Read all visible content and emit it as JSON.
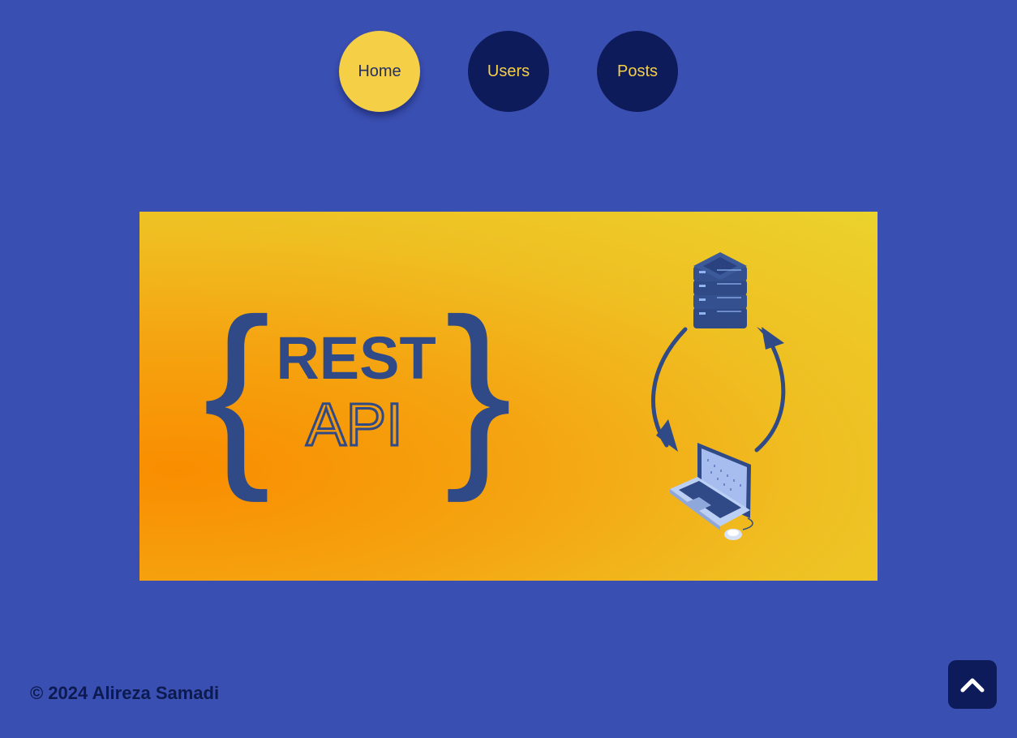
{
  "nav": {
    "items": [
      {
        "label": "Home",
        "active": true
      },
      {
        "label": "Users",
        "active": false
      },
      {
        "label": "Posts",
        "active": false
      }
    ]
  },
  "banner": {
    "title_line1": "REST",
    "title_line2": "API",
    "open_brace": "{",
    "close_brace": "}",
    "icons": [
      "server-stack-icon",
      "cycle-arrows-icon",
      "laptop-icon",
      "mouse-icon"
    ]
  },
  "footer": {
    "copyright": "© 2024 Alireza Samadi"
  },
  "scroll_top": {
    "icon": "chevron-up-icon"
  },
  "colors": {
    "background": "#3a4fb2",
    "accent_yellow": "#f5cf45",
    "navy": "#0e1b5a",
    "banner_ink": "#2f4a86"
  }
}
